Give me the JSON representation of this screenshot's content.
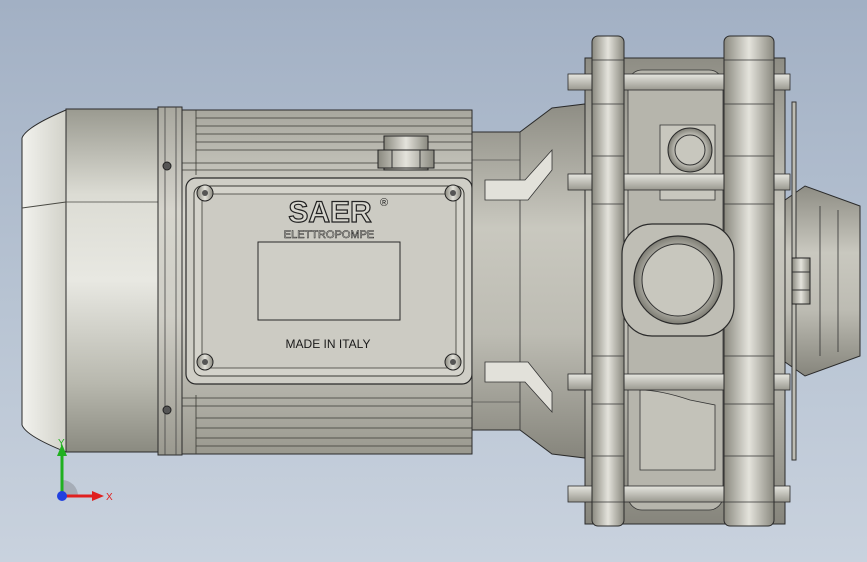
{
  "model": {
    "brand": "SAER",
    "brand_mark": "®",
    "brand_sub": "ELETTROPOMPE",
    "plate_text": "MADE IN ITALY"
  },
  "triad": {
    "y_label": "Y",
    "x_label": "X"
  },
  "colors": {
    "background_top": "#a2b0c4",
    "background_bottom": "#c9d2de",
    "metal": "#c7c6bd",
    "edge": "#2a2a2a",
    "axis_x": "#e02020",
    "axis_y": "#20b020",
    "axis_z": "#2040e0"
  }
}
